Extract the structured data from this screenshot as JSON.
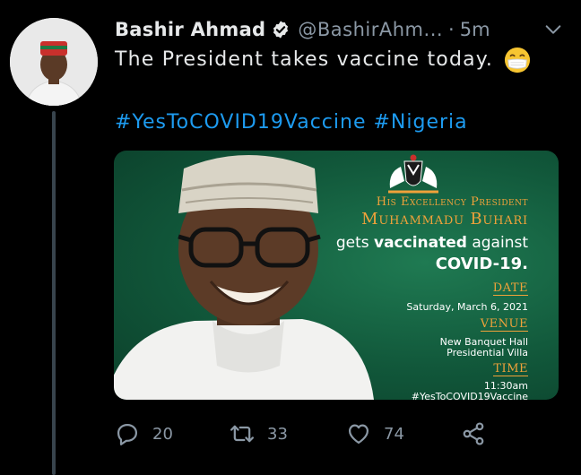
{
  "tweet": {
    "author_name": "Bashir Ahmad",
    "handle": "@BashirAhm...",
    "separator": "·",
    "time": "5m",
    "text": "The President takes vaccine today.",
    "hashtags": [
      "#YesToCOVID19Vaccine",
      "#Nigeria"
    ]
  },
  "media": {
    "line1": "His Excellency President",
    "line2": "Muhammadu Buhari",
    "gets_prefix": "gets",
    "gets_bold": "vaccinated",
    "gets_suffix": "against",
    "covid": "COVID-19.",
    "date_label": "DATE",
    "date_value": "Saturday, March 6, 2021",
    "venue_label": "VENUE",
    "venue_value1": "New Banquet Hall",
    "venue_value2": "Presidential Villa",
    "time_label": "TIME",
    "time_value": "11:30am",
    "hashtag_cut": "#YesToCOVID19Vaccine"
  },
  "actions": {
    "replies": "20",
    "retweets": "33",
    "likes": "74"
  },
  "icons": {
    "verified": "verified-badge-icon",
    "more": "chevron-down-icon",
    "reply": "reply-icon",
    "retweet": "retweet-icon",
    "like": "heart-icon",
    "share": "share-icon",
    "emoji": "face-with-mask-emoji"
  },
  "colors": {
    "background": "#000000",
    "text": "#e7e9ea",
    "muted": "#8b98a5",
    "link": "#1d9bf0",
    "poster_green": "#11573a",
    "poster_gold": "#f0a23a"
  }
}
